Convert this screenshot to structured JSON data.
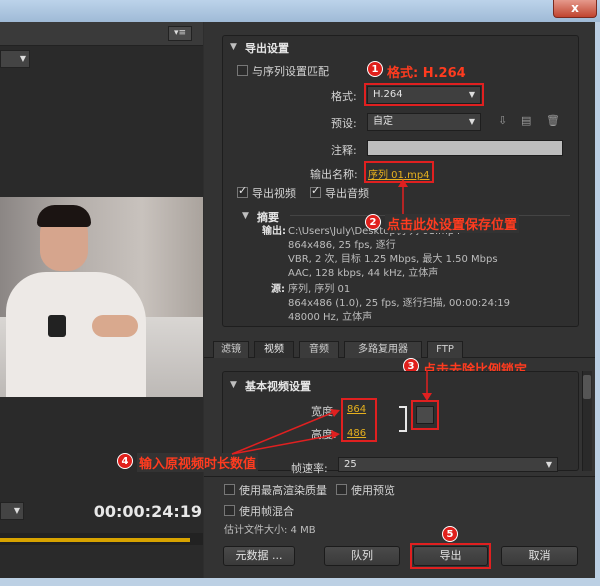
{
  "window": {
    "close_label": "x"
  },
  "preview": {
    "menu_icon": "panel-menu-icon",
    "timecode": "00:00:24:19",
    "dropdown_glyph": "▼"
  },
  "export_settings": {
    "section_title": "导出设置",
    "match_sequence": {
      "label": "与序列设置匹配",
      "checked": false
    },
    "format": {
      "label": "格式:",
      "value": "H.264"
    },
    "preset": {
      "label": "预设:",
      "value": "自定"
    },
    "comment": {
      "label": "注释:",
      "value": ""
    },
    "output_name": {
      "label": "输出名称:",
      "value": "序列 01.mp4"
    },
    "export_video": {
      "label": "导出视频",
      "checked": true
    },
    "export_audio": {
      "label": "导出音频",
      "checked": true
    },
    "summary": {
      "title": "摘要",
      "output_label": "输出:",
      "output_lines": [
        "C:\\Users\\July\\Desktop\\序列 01.mp4",
        "864x486, 25 fps, 逐行",
        "VBR, 2 次, 目标 1.25 Mbps, 最大 1.50 Mbps",
        "AAC, 128 kbps, 44 kHz, 立体声"
      ],
      "source_label": "源:",
      "source_lines": [
        "序列, 序列 01",
        "864x486 (1.0), 25 fps, 逐行扫描, 00:00:24:19",
        "48000 Hz, 立体声"
      ]
    }
  },
  "tabs": [
    {
      "label": "滤镜",
      "active": false
    },
    {
      "label": "视频",
      "active": true
    },
    {
      "label": "音频",
      "active": false
    },
    {
      "label": "多路复用器",
      "active": false
    },
    {
      "label": "FTP",
      "active": false
    }
  ],
  "video_settings": {
    "title": "基本视频设置",
    "width": {
      "label": "宽度:",
      "value": "864"
    },
    "height": {
      "label": "高度:",
      "value": "486"
    },
    "frame_rate": {
      "label": "帧速率:",
      "value": "25"
    }
  },
  "options": {
    "max_render_quality": {
      "label": "使用最高渲染质量",
      "checked": false
    },
    "use_previews": {
      "label": "使用预览",
      "checked": false
    },
    "frame_blending": {
      "label": "使用帧混合",
      "checked": false
    },
    "estimated_size": "估计文件大小: 4 MB"
  },
  "buttons": {
    "metadata": "元数据 ...",
    "queue": "队列",
    "export": "导出",
    "cancel": "取消"
  },
  "annotations": {
    "a1": {
      "num": "1",
      "text": "格式: H.264"
    },
    "a2": {
      "num": "2",
      "text": "点击此处设置保存位置"
    },
    "a3": {
      "num": "3",
      "text": "点击去除比例锁定"
    },
    "a4": {
      "num": "4",
      "text": "输入原视频时长数值"
    },
    "a5": {
      "num": "5"
    }
  },
  "colors": {
    "annotation_red": "#e02020",
    "link_gold": "#e6b01e",
    "progress_gold": "#d8a300"
  }
}
